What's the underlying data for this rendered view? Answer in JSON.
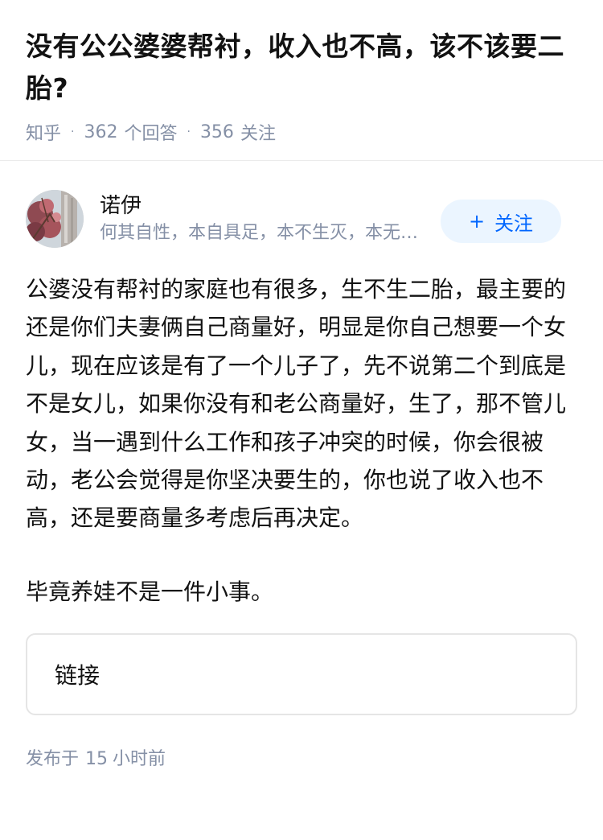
{
  "question": {
    "title": "没有公公婆婆帮衬，收入也不高，该不该要二胎?",
    "source": "知乎",
    "answer_count": "362",
    "answer_label": "个回答",
    "follower_count": "356",
    "follower_label": "关注",
    "separator": "·"
  },
  "author": {
    "name": "诺伊",
    "bio": "何其自性，本自具足，本不生灭，本无动摇，能生万法",
    "follow_icon": "+",
    "follow_label": "关注"
  },
  "answer": {
    "paragraphs": [
      "公婆没有帮衬的家庭也有很多，生不生二胎，最主要的还是你们夫妻俩自己商量好，明显是你自己想要一个女儿，现在应该是有了一个儿子了，先不说第二个到底是不是女儿，如果你没有和老公商量好，生了，那不管儿女，当一遇到什么工作和孩子冲突的时候，你会很被动，老公会觉得是你坚决要生的，你也说了收入也不高，还是要商量多考虑后再决定。",
      "毕竟养娃不是一件小事。"
    ],
    "link_label": "链接",
    "published_prefix": "发布于",
    "published_value": "15",
    "published_suffix": "小时前"
  },
  "colors": {
    "accent": "#0066ff",
    "accent_bg": "#ebf5ff",
    "meta": "#8590a6"
  }
}
